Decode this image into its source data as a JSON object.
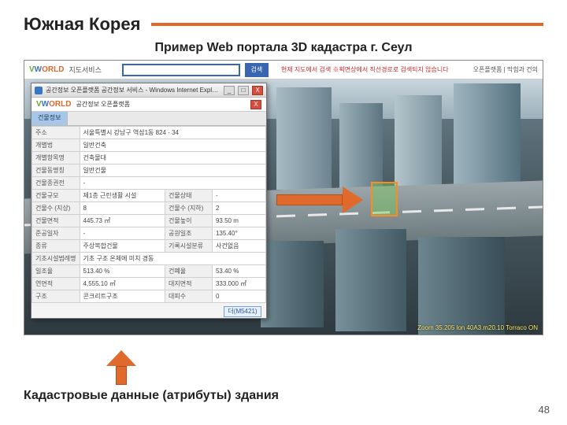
{
  "slide": {
    "title": "Южная Корея",
    "subtitle": "Пример Web портала 3D кадастра г. Сеул",
    "caption": "Кадастровые данные (атрибуты) здания",
    "page_number": "48"
  },
  "portal_header": {
    "logo_text": "VWORLD",
    "logo_sub": "지도서비스",
    "search_button": "검색",
    "warning_note": "현재 지도에서 검색 ※획면상에서 직선경로로 검색되지 않습니다",
    "right_links": "오픈플랫폼 | 막힘과 건의"
  },
  "ie_window": {
    "title": "공간정보 오픈플랫폼 공간정보 서비스 - Windows Internet Explorer",
    "inner_logo": "VWORLD",
    "inner_logo_sub": "공간정보 오픈플랫폼",
    "close_label": "X",
    "tab1": "건물정보",
    "more_button": "더(M5421)"
  },
  "attributes": {
    "rows": [
      {
        "k1": "주소",
        "v1": "서울특별시 강남구 역삼1동 824 - 34",
        "k2": "",
        "v2": ""
      },
      {
        "k1": "개별법",
        "v1": "일반건축",
        "k2": "",
        "v2": ""
      },
      {
        "k1": "개별항목명",
        "v1": "건축물대",
        "k2": "",
        "v2": ""
      },
      {
        "k1": "건물동명칭",
        "v1": "일반건물",
        "k2": "",
        "v2": ""
      },
      {
        "k1": "건물종권전",
        "v1": "-",
        "k2": "",
        "v2": ""
      },
      {
        "k1": "건물규모",
        "v1": "제1층 근린생활 시설",
        "k2": "건물상태",
        "v2": "-"
      },
      {
        "k1": "건물수 (지상)",
        "v1": "8",
        "k2": "건물수 (지하)",
        "v2": "2"
      },
      {
        "k1": "건물면적",
        "v1": "445.73 ㎡",
        "k2": "건물높이",
        "v2": "93.50 m"
      },
      {
        "k1": "준공일자",
        "v1": "-",
        "k2": "공원일조",
        "v2": "135.40°"
      },
      {
        "k1": "종류",
        "v1": "주상복합건물",
        "k2": "기록시설분류",
        "v2": "사건없음"
      },
      {
        "k1": "기초시설범례명",
        "v1": "기초 구조 온체에 미치 경동",
        "k2": "",
        "v2": ""
      },
      {
        "k1": "일조율",
        "v1": "513.40 %",
        "k2": "건폐율",
        "v2": "53.40 %"
      },
      {
        "k1": "연면적",
        "v1": "4,555.10 ㎡",
        "k2": "대지면적",
        "v2": "333.000 ㎡"
      },
      {
        "k1": "구조",
        "v1": "콘크리트구조",
        "k2": "대피수",
        "v2": "0"
      }
    ]
  },
  "map": {
    "coords_readout": "Zoom 35.205   lon 40A3.m20.10   Torraco ON"
  }
}
